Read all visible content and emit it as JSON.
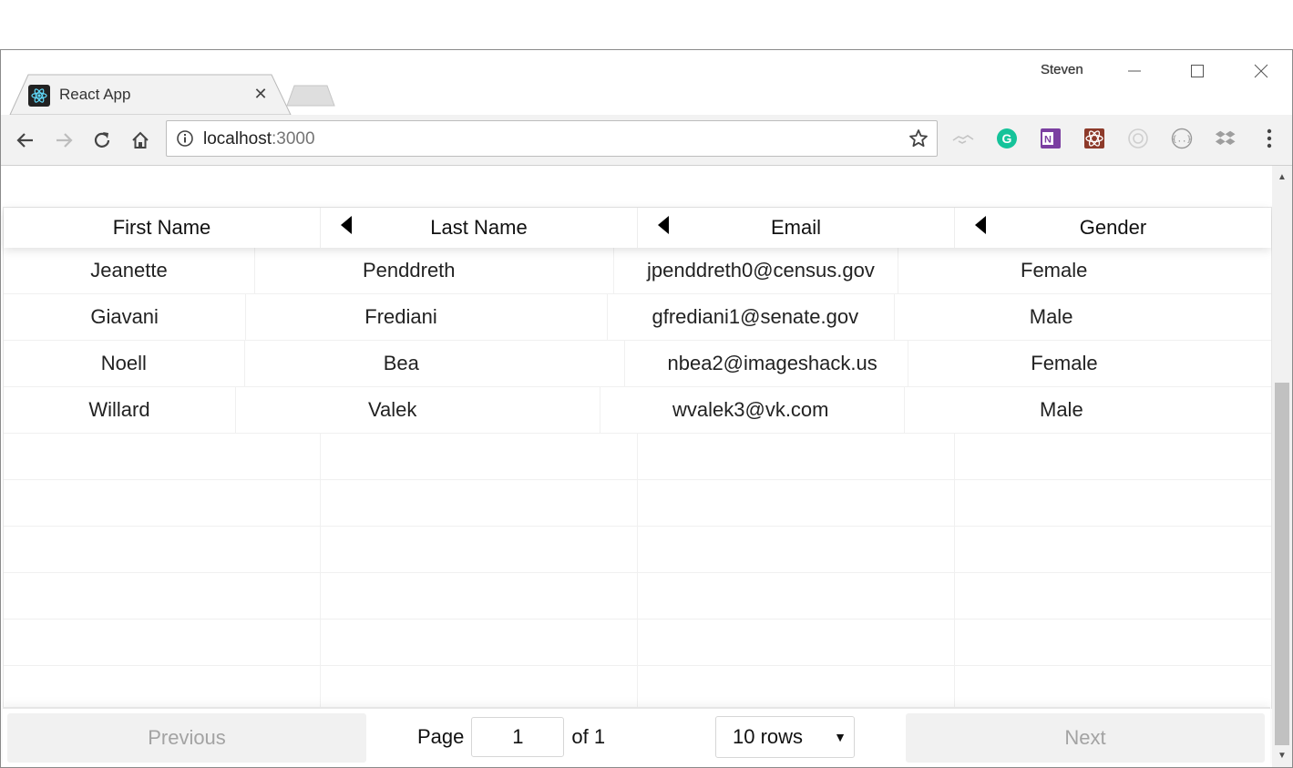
{
  "browser": {
    "profile_name": "Steven",
    "tab": {
      "title": "React App",
      "close_glyph": "✕",
      "favicon": "react-icon"
    },
    "address": {
      "host": "localhost",
      "port": ":3000"
    },
    "nav_icons": [
      "back-icon",
      "forward-icon",
      "reload-icon",
      "home-icon"
    ],
    "extensions": [
      "handshake-icon",
      "grammarly-icon",
      "onenote-icon",
      "react-devtools-icon",
      "camera-icon",
      "json-icon",
      "dropbox-icon",
      "menu-icon"
    ]
  },
  "table": {
    "columns": [
      "First Name",
      "Last Name",
      "Email",
      "Gender"
    ],
    "rows": [
      {
        "first_name": "Jeanette",
        "last_name": "Penddreth",
        "email": "jpenddreth0@census.gov",
        "gender": "Female"
      },
      {
        "first_name": "Giavani",
        "last_name": "Frediani",
        "email": "gfrediani1@senate.gov",
        "gender": "Male"
      },
      {
        "first_name": "Noell",
        "last_name": "Bea",
        "email": "nbea2@imageshack.us",
        "gender": "Female"
      },
      {
        "first_name": "Willard",
        "last_name": "Valek",
        "email": "wvalek3@vk.com",
        "gender": "Male"
      }
    ],
    "empty_rows": 6
  },
  "pagination": {
    "previous_label": "Previous",
    "next_label": "Next",
    "page_label": "Page",
    "current_page": "1",
    "of_label": "of 1",
    "rows_select": "10 rows"
  },
  "colors": {
    "button_bg": "#f1f1f1",
    "button_text_disabled": "#a3a3a3",
    "toolbar_bg": "#f2f2f2"
  }
}
